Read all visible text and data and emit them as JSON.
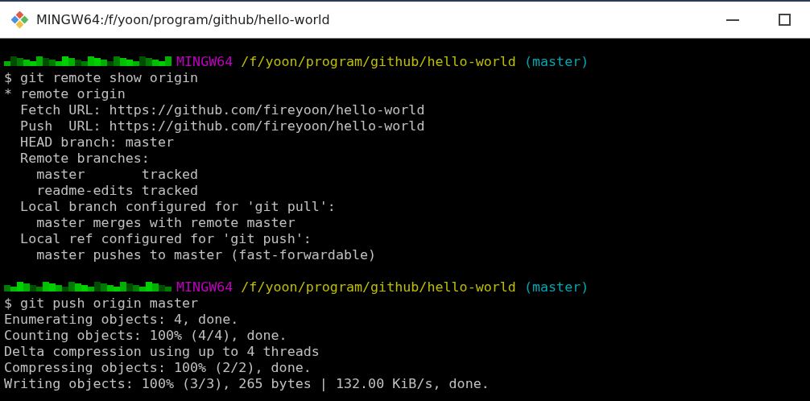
{
  "window": {
    "title": "MINGW64:/f/yoon/program/github/hello-world"
  },
  "terminal": {
    "lines": [
      {
        "kind": "prompt",
        "shell": "MINGW64",
        "path": "/f/yoon/program/github/hello-world",
        "branch": "(master)"
      },
      {
        "kind": "output",
        "text": "$ git remote show origin"
      },
      {
        "kind": "output",
        "text": "* remote origin"
      },
      {
        "kind": "output",
        "text": "  Fetch URL: https://github.com/fireyoon/hello-world"
      },
      {
        "kind": "output",
        "text": "  Push  URL: https://github.com/fireyoon/hello-world"
      },
      {
        "kind": "output",
        "text": "  HEAD branch: master"
      },
      {
        "kind": "output",
        "text": "  Remote branches:"
      },
      {
        "kind": "output",
        "text": "    master       tracked"
      },
      {
        "kind": "output",
        "text": "    readme-edits tracked"
      },
      {
        "kind": "output",
        "text": "  Local branch configured for 'git pull':"
      },
      {
        "kind": "output",
        "text": "    master merges with remote master"
      },
      {
        "kind": "output",
        "text": "  Local ref configured for 'git push':"
      },
      {
        "kind": "output",
        "text": "    master pushes to master (fast-forwardable)"
      },
      {
        "kind": "blank"
      },
      {
        "kind": "prompt",
        "shell": "MINGW64",
        "path": "/f/yoon/program/github/hello-world",
        "branch": "(master)"
      },
      {
        "kind": "output",
        "text": "$ git push origin master"
      },
      {
        "kind": "output",
        "text": "Enumerating objects: 4, done."
      },
      {
        "kind": "output",
        "text": "Counting objects: 100% (4/4), done."
      },
      {
        "kind": "output",
        "text": "Delta compression using up to 4 threads"
      },
      {
        "kind": "output",
        "text": "Compressing objects: 100% (2/2), done."
      },
      {
        "kind": "output",
        "text": "Writing objects: 100% (3/3), 265 bytes | 132.00 KiB/s, done."
      }
    ]
  }
}
